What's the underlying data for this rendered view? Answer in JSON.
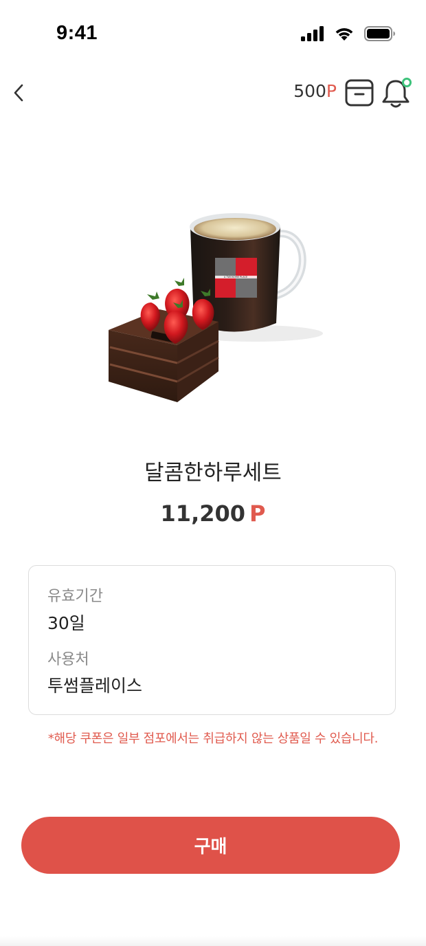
{
  "status_bar": {
    "time": "9:41"
  },
  "header": {
    "points_value": "500",
    "points_unit": "P",
    "icons": [
      "back-chevron-icon",
      "archive-box-icon",
      "bell-icon"
    ],
    "bell_badge_color": "#3cc27a"
  },
  "product": {
    "image_label": "A TWOSOME PLACE",
    "name": "달콤한하루세트",
    "price_value": "11,200",
    "price_unit": "P"
  },
  "info": {
    "validity_label": "유효기간",
    "validity_value": "30일",
    "place_label": "사용처",
    "place_value": "투썸플레이스"
  },
  "notice": "*해당 쿠폰은 일부 점포에서는 취급하지 않는 상품일 수 있습니다.",
  "buy_button_label": "구매",
  "colors": {
    "accent": "#df5249",
    "point_red": "#e05a4e",
    "border": "#dcdcdc"
  }
}
